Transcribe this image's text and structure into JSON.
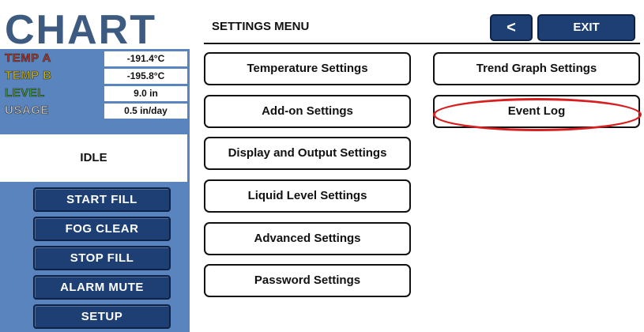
{
  "brand": {
    "logo_text": "CHART"
  },
  "readings": [
    {
      "label": "TEMP A",
      "value": "-191.4°C",
      "color": "#b5382c"
    },
    {
      "label": "TEMP B",
      "value": "-195.8°C",
      "color": "#c9b420"
    },
    {
      "label": "LEVEL",
      "value": "9.0 in",
      "color": "#3d9d3b"
    },
    {
      "label": "USAGE",
      "value": "0.5 in/day",
      "color": "#c4ccd8"
    }
  ],
  "status": {
    "text": "IDLE"
  },
  "sidebar_buttons": [
    {
      "label": "START FILL"
    },
    {
      "label": "FOG CLEAR"
    },
    {
      "label": "STOP FILL"
    },
    {
      "label": "ALARM MUTE"
    },
    {
      "label": "SETUP"
    }
  ],
  "header": {
    "title": "SETTINGS MENU",
    "back_label": "<",
    "exit_label": "EXIT"
  },
  "settings_left": [
    {
      "label": "Temperature Settings"
    },
    {
      "label": "Add-on Settings"
    },
    {
      "label": "Display and Output Settings"
    },
    {
      "label": "Liquid Level Settings"
    },
    {
      "label": "Advanced Settings"
    },
    {
      "label": "Password Settings"
    }
  ],
  "settings_right": [
    {
      "label": "Trend Graph Settings"
    },
    {
      "label": "Event Log"
    }
  ],
  "colors": {
    "brand": "#3d5a80",
    "sidebar": "#5a84bd",
    "button": "#1d3f73",
    "highlight": "#d81e1e"
  }
}
